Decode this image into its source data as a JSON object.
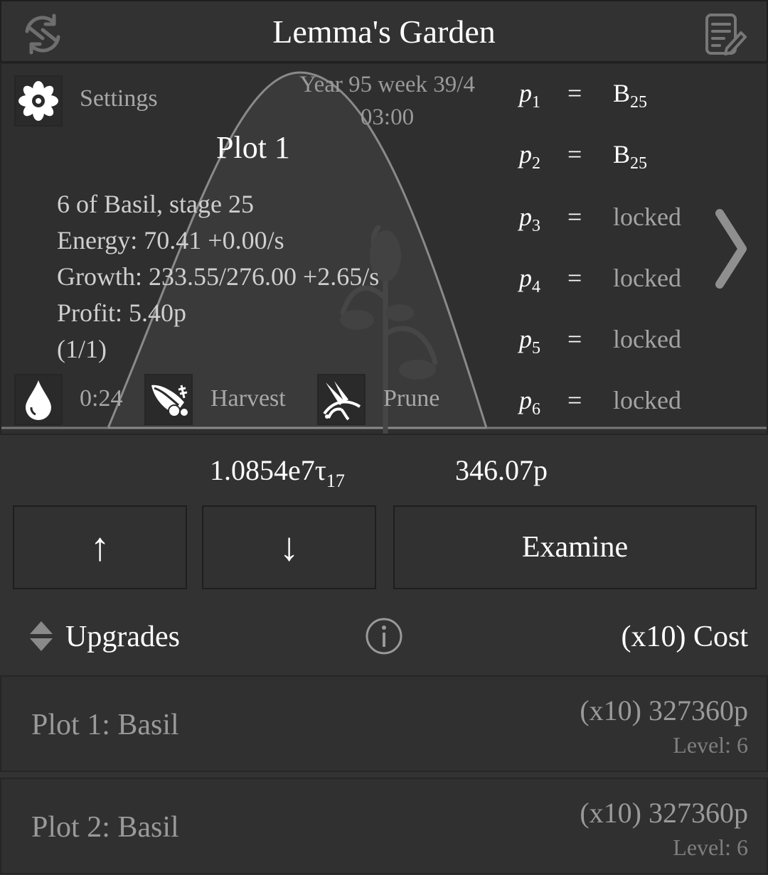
{
  "header": {
    "title": "Lemma's Garden",
    "refresh_icon": "refresh-icon",
    "notes_icon": "notes-edit-icon"
  },
  "garden": {
    "date_line1": "Year 95 week 39/4",
    "date_line2": "03:00",
    "settings_label": "Settings",
    "settings_icon": "flower-icon",
    "plot_title": "Plot 1",
    "info": {
      "line1": "6 of Basil, stage 25",
      "line2": "Energy: 70.41 +0.00/s",
      "line3": "Growth: 233.55/276.00 +2.65/s",
      "line4": "Profit: 5.40p",
      "line5": "(1/1)"
    },
    "actions": {
      "water_timer": "0:24",
      "water_icon": "water-drop-icon",
      "harvest_label": "Harvest",
      "harvest_icon": "cornucopia-icon",
      "prune_label": "Prune",
      "prune_icon": "prune-scissors-icon"
    },
    "params": [
      {
        "p": "p",
        "idx": "1",
        "eq": "=",
        "val": "B",
        "sub": "25"
      },
      {
        "p": "p",
        "idx": "2",
        "eq": "=",
        "val": "B",
        "sub": "25"
      },
      {
        "p": "p",
        "idx": "3",
        "eq": "=",
        "val": "locked",
        "sub": ""
      },
      {
        "p": "p",
        "idx": "4",
        "eq": "=",
        "val": "locked",
        "sub": ""
      },
      {
        "p": "p",
        "idx": "5",
        "eq": "=",
        "val": "locked",
        "sub": ""
      },
      {
        "p": "p",
        "idx": "6",
        "eq": "=",
        "val": "locked",
        "sub": ""
      }
    ],
    "next_icon": "chevron-right-icon"
  },
  "currency": {
    "tau_value": "1.0854e7τ",
    "tau_sub": "17",
    "profit": "346.07p"
  },
  "buttons": {
    "up": "↑",
    "down": "↓",
    "examine": "Examine"
  },
  "upgrades": {
    "label": "Upgrades",
    "cost_header": "(x10) Cost",
    "sort_icon": "sort-arrows-icon",
    "info_icon": "info-icon",
    "rows": [
      {
        "name": "Plot 1: Basil",
        "price": "(x10) 327360p",
        "level": "Level: 6"
      },
      {
        "name": "Plot 2: Basil",
        "price": "(x10) 327360p",
        "level": "Level: 6"
      }
    ]
  }
}
